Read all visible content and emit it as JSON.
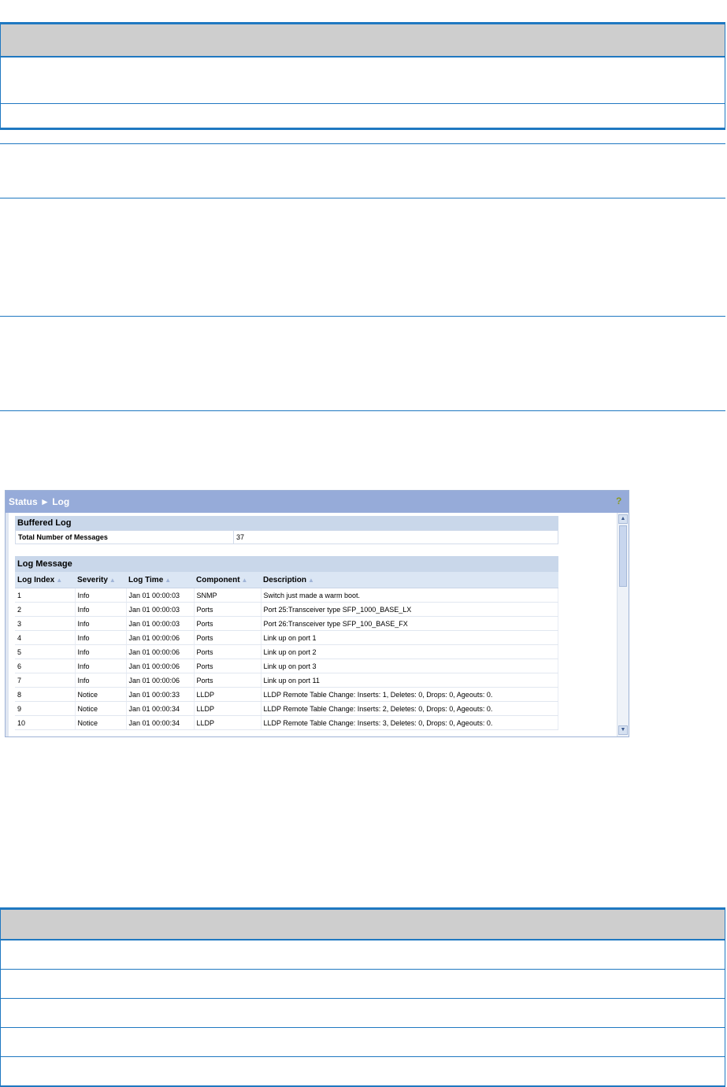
{
  "screenshot": {
    "title": "Status ► Log",
    "help_icon": "question-mark",
    "buffered_log": {
      "title": "Buffered Log",
      "total_label": "Total Number of Messages",
      "total_value": "37"
    },
    "log_message": {
      "title": "Log Message",
      "columns": [
        "Log Index",
        "Severity",
        "Log Time",
        "Component",
        "Description"
      ],
      "rows": [
        [
          "1",
          "Info",
          "Jan 01 00:00:03",
          "SNMP",
          "Switch just made a warm boot."
        ],
        [
          "2",
          "Info",
          "Jan 01 00:00:03",
          "Ports",
          "Port 25:Transceiver type SFP_1000_BASE_LX"
        ],
        [
          "3",
          "Info",
          "Jan 01 00:00:03",
          "Ports",
          "Port 26:Transceiver type SFP_100_BASE_FX"
        ],
        [
          "4",
          "Info",
          "Jan 01 00:00:06",
          "Ports",
          "Link up on port 1"
        ],
        [
          "5",
          "Info",
          "Jan 01 00:00:06",
          "Ports",
          "Link up on port 2"
        ],
        [
          "6",
          "Info",
          "Jan 01 00:00:06",
          "Ports",
          "Link up on port 3"
        ],
        [
          "7",
          "Info",
          "Jan 01 00:00:06",
          "Ports",
          "Link up on port 11"
        ],
        [
          "8",
          "Notice",
          "Jan 01 00:00:33",
          "LLDP",
          "LLDP Remote Table Change: Inserts: 1, Deletes: 0, Drops: 0, Ageouts: 0."
        ],
        [
          "9",
          "Notice",
          "Jan 01 00:00:34",
          "LLDP",
          "LLDP Remote Table Change: Inserts: 2, Deletes: 0, Drops: 0, Ageouts: 0."
        ],
        [
          "10",
          "Notice",
          "Jan 01 00:00:34",
          "LLDP",
          "LLDP Remote Table Change: Inserts: 3, Deletes: 0, Drops: 0, Ageouts: 0."
        ]
      ]
    }
  }
}
